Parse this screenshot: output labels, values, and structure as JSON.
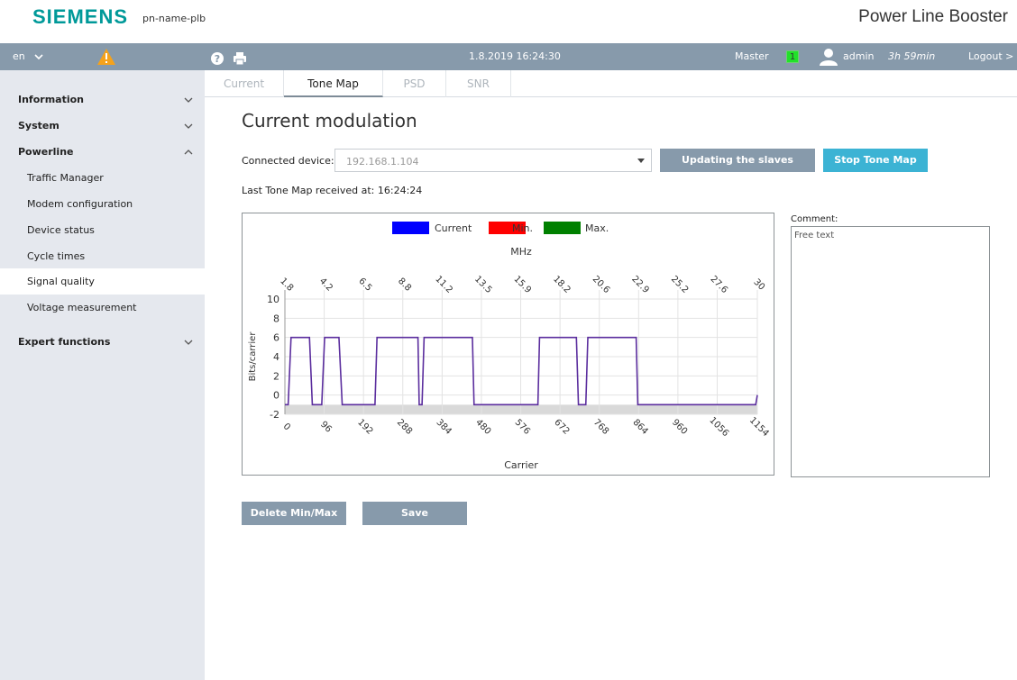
{
  "header": {
    "brand": "SIEMENS",
    "device_name": "pn-name-plb",
    "product_name": "Power Line Booster"
  },
  "toolbar": {
    "language": "en",
    "datetime": "1.8.2019 16:24:30",
    "role": "Master",
    "master_count": "1",
    "username": "admin",
    "session_time": "3h 59min",
    "logout_label": "Logout >",
    "warning_color": "#f5a21b"
  },
  "sidebar": {
    "items": [
      {
        "label": "Information"
      },
      {
        "label": "System"
      },
      {
        "label": "Powerline"
      },
      {
        "label": "Traffic Manager"
      },
      {
        "label": "Modem configuration"
      },
      {
        "label": "Device status"
      },
      {
        "label": "Cycle times"
      },
      {
        "label": "Signal quality"
      },
      {
        "label": "Voltage measurement"
      },
      {
        "label": "Expert functions"
      }
    ]
  },
  "tabs": [
    {
      "label": "Current"
    },
    {
      "label": "Tone Map"
    },
    {
      "label": "PSD"
    },
    {
      "label": "SNR"
    }
  ],
  "main": {
    "title": "Current modulation",
    "connected_device_label": "Connected device:",
    "connected_device_value": "192.168.1.104",
    "update_button": "Updating the slaves",
    "stop_button": "Stop Tone Map",
    "last_received": "Last Tone Map received at: 16:24:24",
    "comment_label": "Comment:",
    "comment_text": "Free text",
    "delete_button": "Delete Min/Max",
    "save_button": "Save"
  },
  "chart_data": {
    "type": "line",
    "title": "",
    "xlabel": "Carrier",
    "ylabel": "Bits/carrier",
    "x2label": "MHz",
    "legend": [
      "Current",
      "Min.",
      "Max."
    ],
    "legend_colors": [
      "#0000ff",
      "#ff0000",
      "#008000"
    ],
    "legend_placement": "top",
    "line_color": "#5b2e9e",
    "xlim": [
      0,
      1154
    ],
    "ylim": [
      -2,
      10
    ],
    "x_ticks": [
      0,
      96,
      192,
      288,
      384,
      480,
      576,
      672,
      768,
      864,
      960,
      1056,
      1154
    ],
    "x_tick_labels": [
      "0",
      "96",
      "192",
      "288",
      "384",
      "480",
      "576",
      "672",
      "768",
      "864",
      "960",
      "1056",
      "1154"
    ],
    "x2_tick_labels": [
      "1.8",
      "4.2",
      "6.5",
      "8.8",
      "11.2",
      "13.5",
      "15.9",
      "18.2",
      "20.6",
      "22.9",
      "25.2",
      "27.6",
      "30"
    ],
    "y_ticks": [
      -2,
      0,
      2,
      4,
      6,
      8,
      10
    ],
    "shaded_band": [
      -2,
      -1
    ],
    "grid": true,
    "series": [
      {
        "name": "Current",
        "x": [
          0,
          8,
          15,
          60,
          67,
          90,
          97,
          132,
          140,
          220,
          225,
          325,
          328,
          335,
          340,
          458,
          462,
          618,
          622,
          712,
          717,
          735,
          740,
          858,
          862,
          1150,
          1154
        ],
        "y": [
          -1,
          -1,
          6,
          6,
          -1,
          -1,
          6,
          6,
          -1,
          -1,
          6,
          6,
          -1,
          -1,
          6,
          6,
          -1,
          -1,
          6,
          6,
          -1,
          -1,
          6,
          6,
          -1,
          -1,
          0
        ]
      }
    ]
  }
}
